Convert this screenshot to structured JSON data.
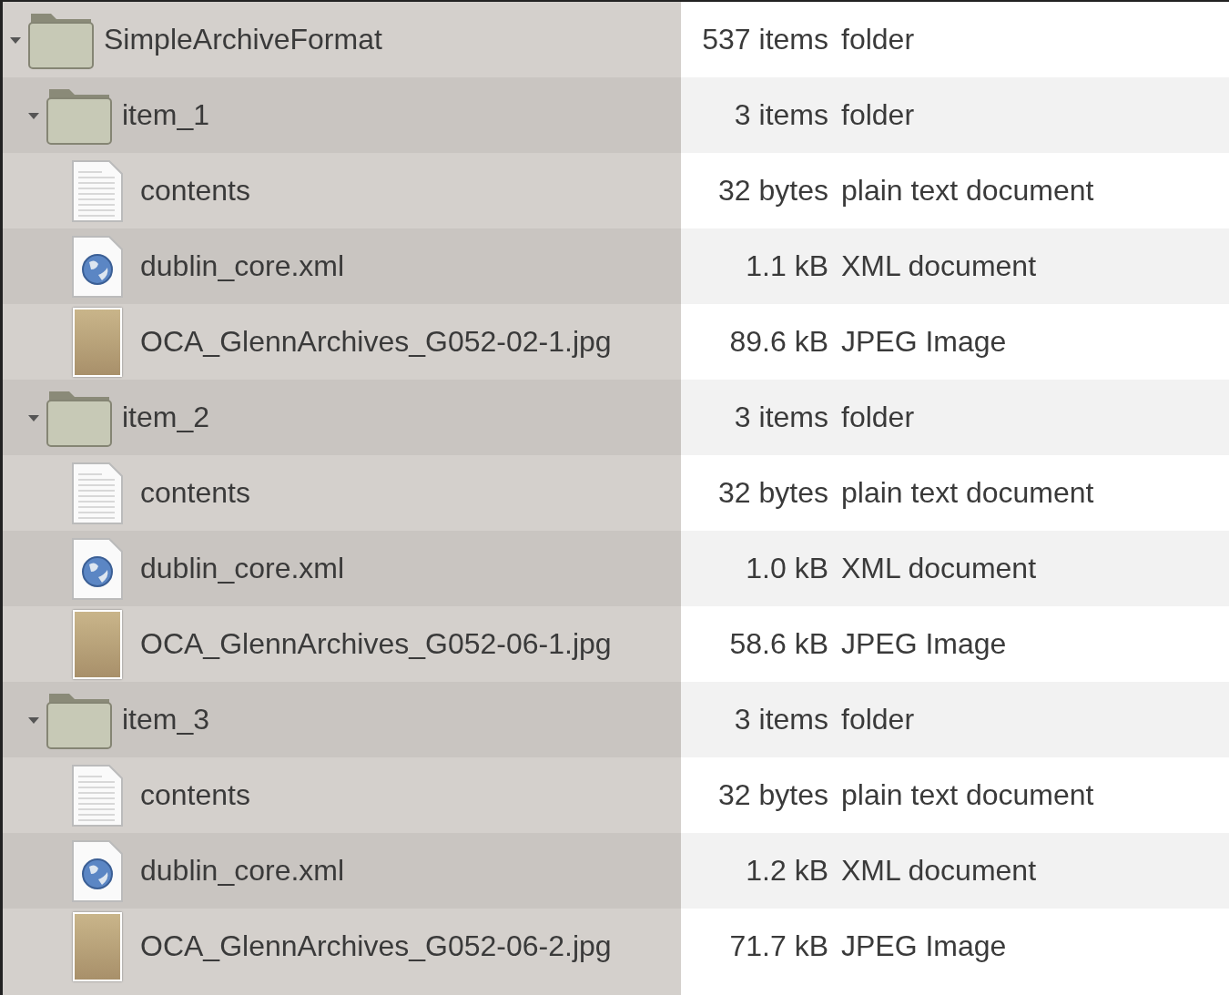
{
  "tree": [
    {
      "kind": "folder",
      "name": "SimpleArchiveFormat",
      "size": "537 items",
      "type": "folder",
      "expanded": true,
      "children": [
        {
          "kind": "folder",
          "name": "item_1",
          "size": "3 items",
          "type": "folder",
          "expanded": true,
          "children": [
            {
              "kind": "text",
              "name": "contents",
              "size": "32 bytes",
              "type": "plain text document"
            },
            {
              "kind": "xml",
              "name": "dublin_core.xml",
              "size": "1.1 kB",
              "type": "XML document"
            },
            {
              "kind": "image",
              "name": "OCA_GlennArchives_G052-02-1.jpg",
              "size": "89.6 kB",
              "type": "JPEG Image"
            }
          ]
        },
        {
          "kind": "folder",
          "name": "item_2",
          "size": "3 items",
          "type": "folder",
          "expanded": true,
          "children": [
            {
              "kind": "text",
              "name": "contents",
              "size": "32 bytes",
              "type": "plain text document"
            },
            {
              "kind": "xml",
              "name": "dublin_core.xml",
              "size": "1.0 kB",
              "type": "XML document"
            },
            {
              "kind": "image",
              "name": "OCA_GlennArchives_G052-06-1.jpg",
              "size": "58.6 kB",
              "type": "JPEG Image"
            }
          ]
        },
        {
          "kind": "folder",
          "name": "item_3",
          "size": "3 items",
          "type": "folder",
          "expanded": true,
          "children": [
            {
              "kind": "text",
              "name": "contents",
              "size": "32 bytes",
              "type": "plain text document"
            },
            {
              "kind": "xml",
              "name": "dublin_core.xml",
              "size": "1.2 kB",
              "type": "XML document"
            },
            {
              "kind": "image",
              "name": "OCA_GlennArchives_G052-06-2.jpg",
              "size": "71.7 kB",
              "type": "JPEG Image"
            }
          ]
        }
      ]
    }
  ]
}
